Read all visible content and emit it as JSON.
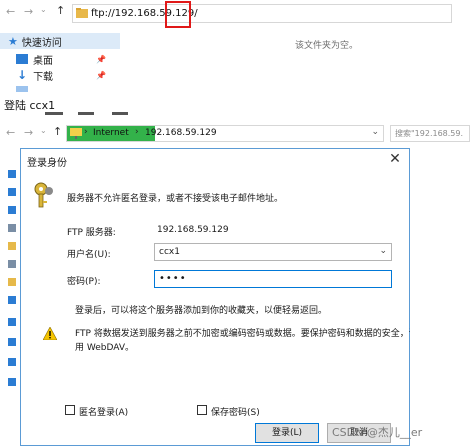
{
  "top_explorer": {
    "address": "ftp://192.168.59.129/",
    "quick_access_label": "快速访问",
    "items": [
      {
        "label": "桌面"
      },
      {
        "label": "下载"
      }
    ],
    "empty_message": "该文件夹为空。"
  },
  "caption": "登陆 ccx1",
  "second_explorer": {
    "address_segments": [
      "Internet",
      "192.168.59.129"
    ],
    "search_placeholder": "搜索\"192.168.59."
  },
  "dialog": {
    "title": "登录身份",
    "anon_message": "服务器不允许匿名登录，或者不接受该电子邮件地址。",
    "server_label": "FTP 服务器:",
    "server_value": "192.168.59.129",
    "username_label": "用户名(U):",
    "username_value": "ccx1",
    "password_label": "密码(P):",
    "password_value": "••••",
    "info_text": "登录后，可以将这个服务器添加到你的收藏夹，以便轻易返回。",
    "warning_line1": "FTP 将数据发送到服务器之前不加密或编码密码或数据。要保护密码和数据的安全，请使",
    "warning_line2": "用 WebDAV。",
    "anonymous_label": "匿名登录(A)",
    "save_password_label": "保存密码(S)",
    "login_button": "登录(L)",
    "cancel_button": "取消"
  },
  "watermark": "CSDN @杰儿__er",
  "colors": {
    "accent": "#0078d7",
    "address_highlight": "#33b24a",
    "red_box": "#e01818",
    "warning": "#f5c400"
  }
}
